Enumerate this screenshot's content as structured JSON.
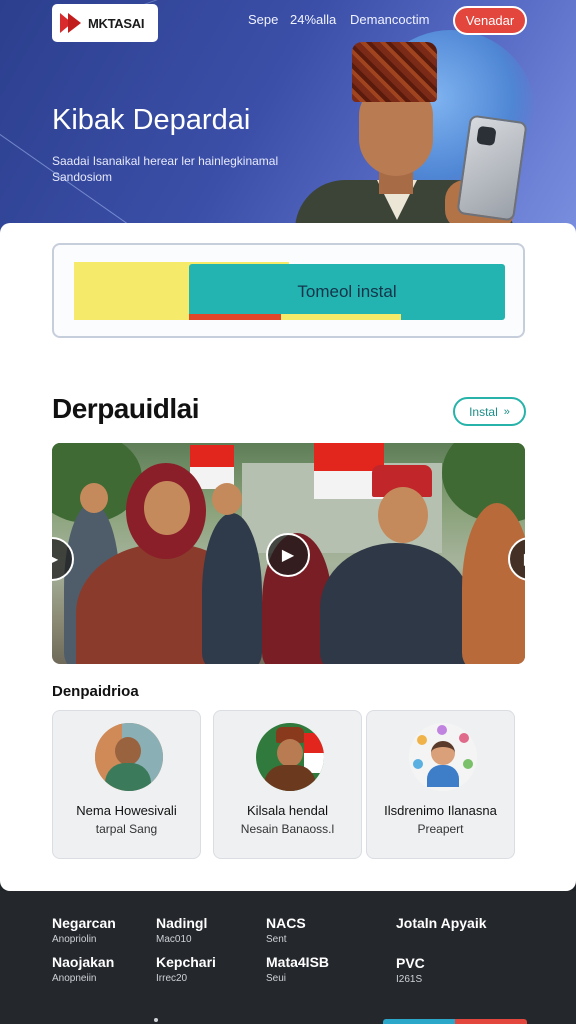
{
  "brand": {
    "name": "MKTASAI",
    "tagline": ""
  },
  "nav": {
    "items": [
      "Sepe",
      "24%alla",
      "Demancoctim"
    ],
    "cta": "Venadar"
  },
  "hero": {
    "title": "Kibak Depardai",
    "subtitle": "Saadai Isanaikal herear ler hainlegkinamal Sandosiom"
  },
  "install": {
    "button_label": "Tomeol instal"
  },
  "section": {
    "title": "Derpauidlai",
    "button_label": "Instal",
    "button_icon": "double-chevron-right-icon"
  },
  "gallery": {
    "subtitle": "Denpaidrioa"
  },
  "tiles": [
    {
      "name": "Nema Howesivali",
      "sub": "tarpal Sang"
    },
    {
      "name": "Kilsala hendal",
      "sub": "Nesain Banaoss.l"
    },
    {
      "name": "Ilsdrenimo Ilanasna",
      "sub": "Preapert"
    }
  ],
  "footer": {
    "columns": [
      {
        "h1": "Negarcan",
        "s1": "Anopriolin",
        "h2": "Naojakan",
        "s2": "Anopneiin"
      },
      {
        "h1": "Nadingl",
        "s1": "Mac010",
        "h2": "Kepchari",
        "s2": "Irrec20"
      },
      {
        "h1": "NACS",
        "s1": "Sent",
        "h2": "Mata4ISB",
        "s2": "Seui"
      },
      {
        "h1": "Jotaln Apyaik",
        "s1": "",
        "h2": "PVC",
        "s2": "I261S"
      }
    ]
  },
  "colors": {
    "hero_gradient_start": "#2c3f8e",
    "accent_red": "#e2463d",
    "accent_teal": "#23b4b1",
    "accent_yellow": "#f6ea6b",
    "footer_bg": "#24272c"
  }
}
